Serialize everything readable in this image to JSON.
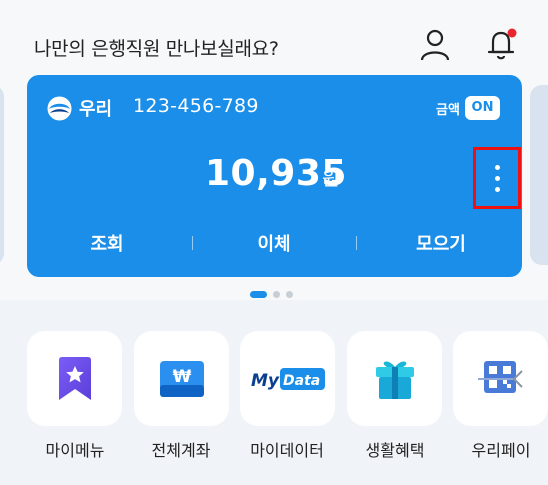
{
  "header": {
    "title": "나만의 은행직원 만나보실래요?",
    "profile_icon": "person-outline-icon",
    "bell_icon": "bell-icon",
    "notification_color": "#e8262d"
  },
  "account_card": {
    "bank_name": "우리",
    "account_number": "123-456-789",
    "amount_label": "금액",
    "toggle_label": "ON",
    "balance": "10,935",
    "currency": "원",
    "actions": [
      "조회",
      "이체",
      "모으기"
    ],
    "card_color": "#1a8ee8",
    "highlight_color": "#ee1111"
  },
  "pager": {
    "count": 3,
    "active_index": 0
  },
  "menu": [
    {
      "label": "마이메뉴",
      "icon": "bookmark-star-icon"
    },
    {
      "label": "전체계좌",
      "icon": "won-wallet-icon"
    },
    {
      "label": "마이데이터",
      "icon": "mydata-logo-icon",
      "logo_text": "My Data"
    },
    {
      "label": "생활혜택",
      "icon": "gift-box-icon"
    },
    {
      "label": "우리페이",
      "icon": "qr-pay-icon"
    }
  ]
}
